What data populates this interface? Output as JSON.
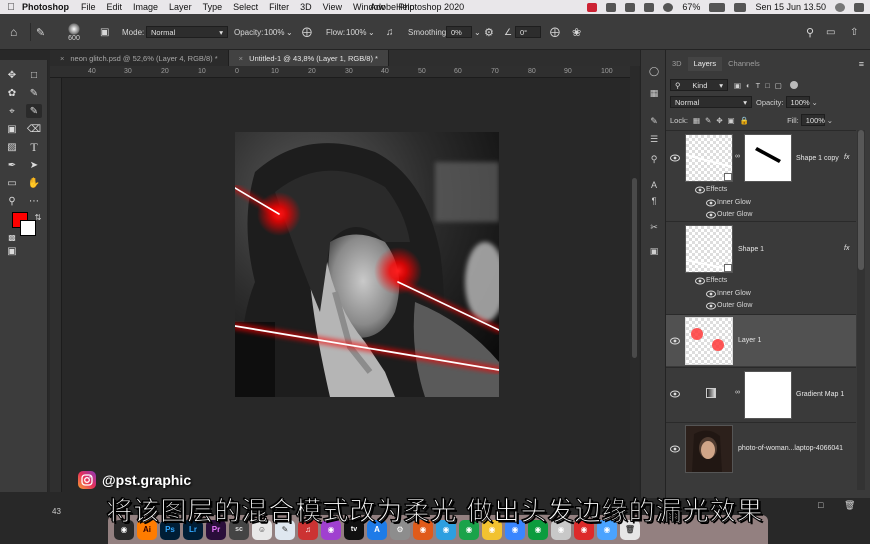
{
  "menubar": {
    "app_name": "Photoshop",
    "items": [
      "File",
      "Edit",
      "Image",
      "Layer",
      "Type",
      "Select",
      "Filter",
      "3D",
      "View",
      "Window",
      "Help"
    ],
    "window_title": "Adobe Photoshop 2020",
    "battery": "67%",
    "datetime": "Sen 15 Jun  13.50"
  },
  "options_bar": {
    "brush_size": "600",
    "mode_label": "Mode:",
    "mode_value": "Normal",
    "opacity_label": "Opacity:",
    "opacity_value": "100%",
    "flow_label": "Flow:",
    "flow_value": "100%",
    "smoothing_label": "Smoothing:",
    "smoothing_value": "0%",
    "angle_value": "0°"
  },
  "tabs": [
    {
      "label": "neon glitch.psd @ 52,6% (Layer 4, RGB/8) *",
      "active": false
    },
    {
      "label": "Untitled-1 @ 43,8% (Layer 1, RGB/8) *",
      "active": true
    }
  ],
  "ruler_ticks": [
    "40",
    "30",
    "20",
    "10",
    "0",
    "10",
    "20",
    "30",
    "40",
    "50",
    "60",
    "70",
    "80",
    "90",
    "100"
  ],
  "colors": {
    "foreground": "#ff0000",
    "background": "#ffffff",
    "neon": "#ff1a1a"
  },
  "layers_panel": {
    "tabs": [
      "3D",
      "Layers",
      "Channels"
    ],
    "active_tab": "Layers",
    "filter_kind": "Kind",
    "blend_mode": "Normal",
    "opacity_label": "Opacity:",
    "opacity_value": "100%",
    "lock_label": "Lock:",
    "fill_label": "Fill:",
    "fill_value": "100%",
    "layers": [
      {
        "name": "Shape 1 copy",
        "fx": "fx",
        "effects_label": "Effects",
        "effects": [
          "Inner Glow",
          "Outer Glow"
        ]
      },
      {
        "name": "Shape 1",
        "fx": "fx",
        "effects_label": "Effects",
        "effects": [
          "Inner Glow",
          "Outer Glow"
        ]
      },
      {
        "name": "Layer 1",
        "selected": true
      },
      {
        "name": "Gradient Map 1"
      },
      {
        "name": "photo-of-woman...laptop-4066041"
      }
    ]
  },
  "status": {
    "zoom": "43"
  },
  "watermark": {
    "handle": "@pst.graphic"
  },
  "subtitle": "将该图层的混合模式改为柔光 做出头发边缘的漏光效果",
  "dock_apps": [
    "Ai",
    "Ps",
    "Lr",
    "Pr",
    "sc",
    "tv",
    "A"
  ]
}
